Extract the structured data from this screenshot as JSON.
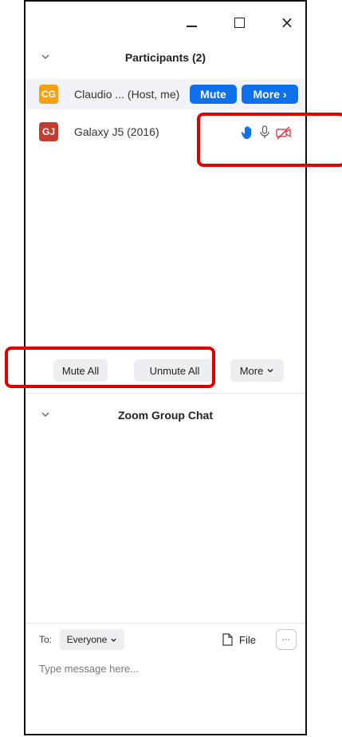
{
  "window": {
    "close_glyph": "×"
  },
  "participants": {
    "title": "Participants (2)",
    "items": [
      {
        "initials": "CG",
        "avatar_color": "#f7a012",
        "name": "Claudio ... (Host, me)",
        "mute_label": "Mute",
        "more_label": "More ›"
      },
      {
        "initials": "GJ",
        "avatar_color": "#c43c2f",
        "name": "Galaxy J5 (2016)",
        "status_icons": [
          "raised-hand-icon",
          "microphone-icon",
          "video-off-icon"
        ]
      }
    ],
    "footer": {
      "mute_all": "Mute All",
      "unmute_all": "Unmute All",
      "more": "More"
    }
  },
  "chat": {
    "title": "Zoom Group Chat",
    "to_label": "To:",
    "recipient": "Everyone",
    "file_label": "File",
    "more_glyph": "···",
    "placeholder": "Type message here..."
  },
  "colors": {
    "accent": "#0e71eb",
    "highlight_red": "#e00000",
    "video_off_red": "#e0283a"
  }
}
